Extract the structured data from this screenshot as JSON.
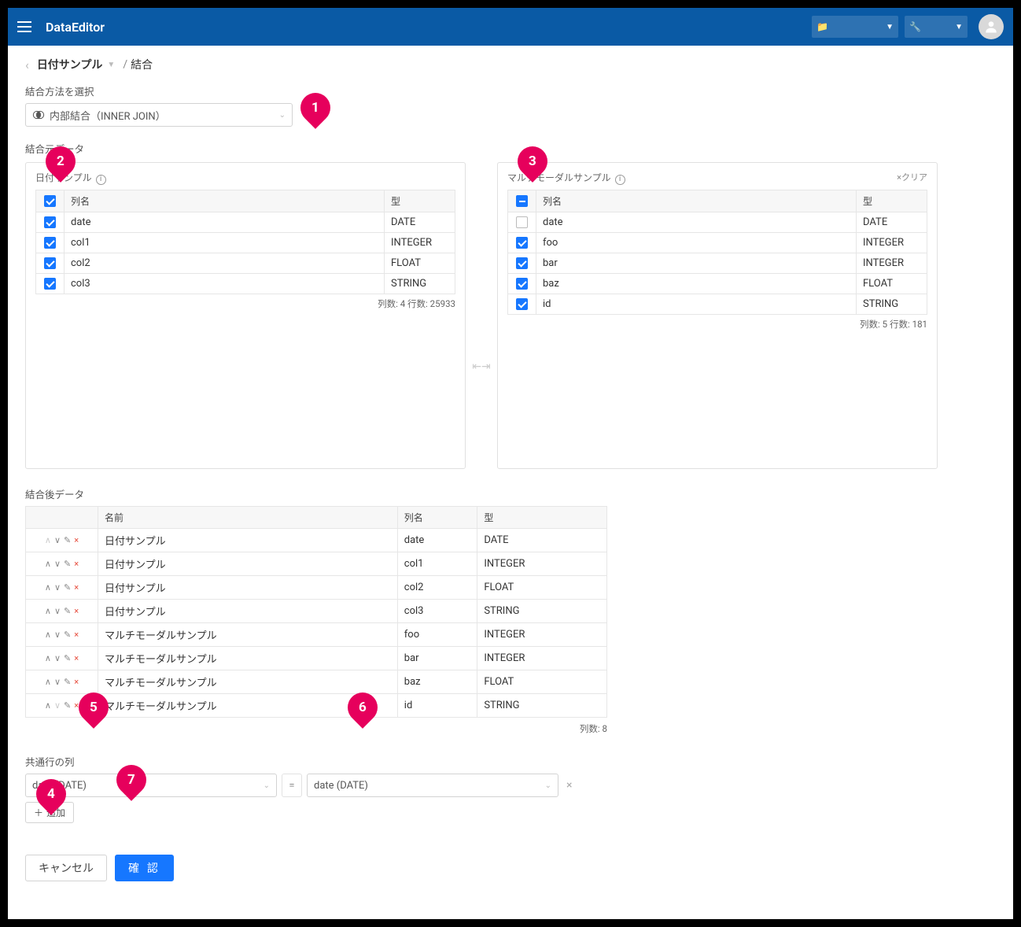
{
  "header": {
    "title": "DataEditor"
  },
  "breadcrumb": {
    "back_icon": "‹",
    "main": "日付サンプル",
    "current": "結合",
    "separator": "/"
  },
  "joinMethod": {
    "label": "結合方法を選択",
    "value": "内部結合（INNER JOIN）"
  },
  "source": {
    "label": "結合元データ",
    "left": {
      "title": "日付サンプル",
      "headers": {
        "col": "列名",
        "type": "型"
      },
      "headerCheckState": "checked",
      "rows": [
        {
          "checked": true,
          "name": "date",
          "type": "DATE"
        },
        {
          "checked": true,
          "name": "col1",
          "type": "INTEGER"
        },
        {
          "checked": true,
          "name": "col2",
          "type": "FLOAT"
        },
        {
          "checked": true,
          "name": "col3",
          "type": "STRING"
        }
      ],
      "footer": "列数: 4    行数: 25933"
    },
    "right": {
      "title": "マルチモーダルサンプル",
      "clear": "×クリア",
      "headers": {
        "col": "列名",
        "type": "型"
      },
      "headerCheckState": "indeterminate",
      "rows": [
        {
          "checked": false,
          "name": "date",
          "type": "DATE"
        },
        {
          "checked": true,
          "name": "foo",
          "type": "INTEGER"
        },
        {
          "checked": true,
          "name": "bar",
          "type": "INTEGER"
        },
        {
          "checked": true,
          "name": "baz",
          "type": "FLOAT"
        },
        {
          "checked": true,
          "name": "id",
          "type": "STRING"
        }
      ],
      "footer": "列数: 5    行数: 181"
    }
  },
  "result": {
    "label": "結合後データ",
    "headers": {
      "name": "名前",
      "col": "列名",
      "type": "型"
    },
    "rows": [
      {
        "src": "日付サンプル",
        "col": "date",
        "type": "DATE",
        "upDim": true,
        "downDim": false
      },
      {
        "src": "日付サンプル",
        "col": "col1",
        "type": "INTEGER",
        "upDim": false,
        "downDim": false
      },
      {
        "src": "日付サンプル",
        "col": "col2",
        "type": "FLOAT",
        "upDim": false,
        "downDim": false
      },
      {
        "src": "日付サンプル",
        "col": "col3",
        "type": "STRING",
        "upDim": false,
        "downDim": false
      },
      {
        "src": "マルチモーダルサンプル",
        "col": "foo",
        "type": "INTEGER",
        "upDim": false,
        "downDim": false
      },
      {
        "src": "マルチモーダルサンプル",
        "col": "bar",
        "type": "INTEGER",
        "upDim": false,
        "downDim": false
      },
      {
        "src": "マルチモーダルサンプル",
        "col": "baz",
        "type": "FLOAT",
        "upDim": false,
        "downDim": false
      },
      {
        "src": "マルチモーダルサンプル",
        "col": "id",
        "type": "STRING",
        "upDim": false,
        "downDim": true
      }
    ],
    "footer": "列数: 8"
  },
  "keys": {
    "label": "共通行の列",
    "left": "date (DATE)",
    "right": "date (DATE)",
    "add": "追加"
  },
  "buttons": {
    "cancel": "キャンセル",
    "confirm": "確 認"
  },
  "callouts": {
    "c1": "1",
    "c2": "2",
    "c3": "3",
    "c4": "4",
    "c5": "5",
    "c6": "6",
    "c7": "7"
  }
}
